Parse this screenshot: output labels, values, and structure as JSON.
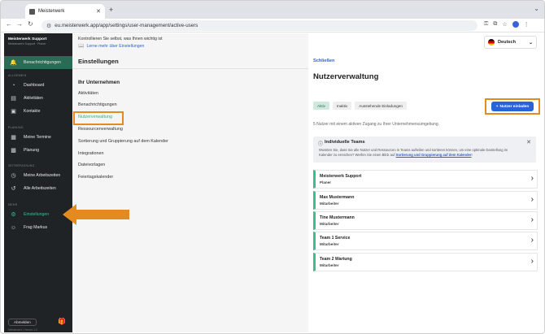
{
  "browser": {
    "tab_title": "Meisterwerk",
    "url": "eu.meisterwerk.app/app/settings/user-management/active-users"
  },
  "sidebar": {
    "org_name": "Meisterwerk Support",
    "org_sub": "Meisterwerk Support · Planer",
    "top_item": "Benachrichtigungen",
    "section_general": "ALLGEMEIN",
    "item_dashboard": "Dashboard",
    "item_activities": "Aktivitäten",
    "item_contacts": "Kontakte",
    "section_planning": "PLANUNG",
    "item_my_appointments": "Meine Termine",
    "item_planning": "Planung",
    "section_time": "ZEITERFASSUNG",
    "item_my_worktimes": "Meine Arbeitszeiten",
    "item_all_worktimes": "Alle Arbeitszeiten",
    "section_more": "MEHR",
    "item_settings": "Einstellungen",
    "item_ask_markus": "Frag Markus",
    "logout": "Abmelden",
    "footer": "Meisterwerk | Version 1.0"
  },
  "info": {
    "text": "Kontrollieren Sie selbst, was Ihnen wichtig ist",
    "link": "Lerne mehr über Einstellungen"
  },
  "settings": {
    "title": "Einstellungen",
    "section": "Ihr Unternehmen",
    "links": [
      "Aktivitäten",
      "Benachrichtigungen",
      "Nutzerverwaltung",
      "Ressourcenverwaltung",
      "Sortierung und Gruppierung auf dem Kalender",
      "Integrationen",
      "Dateivorlagen",
      "Feiertagskalender"
    ]
  },
  "panel": {
    "language": "Deutsch",
    "close": "Schließen",
    "title": "Nutzerverwaltung",
    "chips": [
      "Aktiv",
      "Inaktiv",
      "Ausstehende Einladungen"
    ],
    "invite_button": "Nutzer einladen",
    "count_text": "5 Nutzer mit einem aktiven Zugang zu Ihrer Unternehmensumgebung.",
    "teams_title": "Individuelle Teams",
    "teams_desc": "Wussten Sie, dass Sie alle Nutzer und Ressourcen in Teams aufteilen und sortieren können, um eine optimale Darstellung im Kalender zu erreichen? Werfen Sie einen Blick auf",
    "teams_link": "Sortierung und Gruppierung auf dem Kalender",
    "teams_end": "!",
    "users": [
      {
        "name": "Meisterwerk Support",
        "role": "Planer"
      },
      {
        "name": "Max Mustermann",
        "role": "Mitarbeiter"
      },
      {
        "name": "Tine Mustermann",
        "role": "Mitarbeiter"
      },
      {
        "name": "Team 1 Service",
        "role": "Mitarbeiter"
      },
      {
        "name": "Team 2 Wartung",
        "role": "Mitarbeiter"
      }
    ]
  },
  "colors": {
    "sidebar_bg": "#1f2326",
    "accent_green": "#39c08f",
    "primary_blue": "#2a62d8",
    "highlight_orange": "#e48a1f"
  }
}
